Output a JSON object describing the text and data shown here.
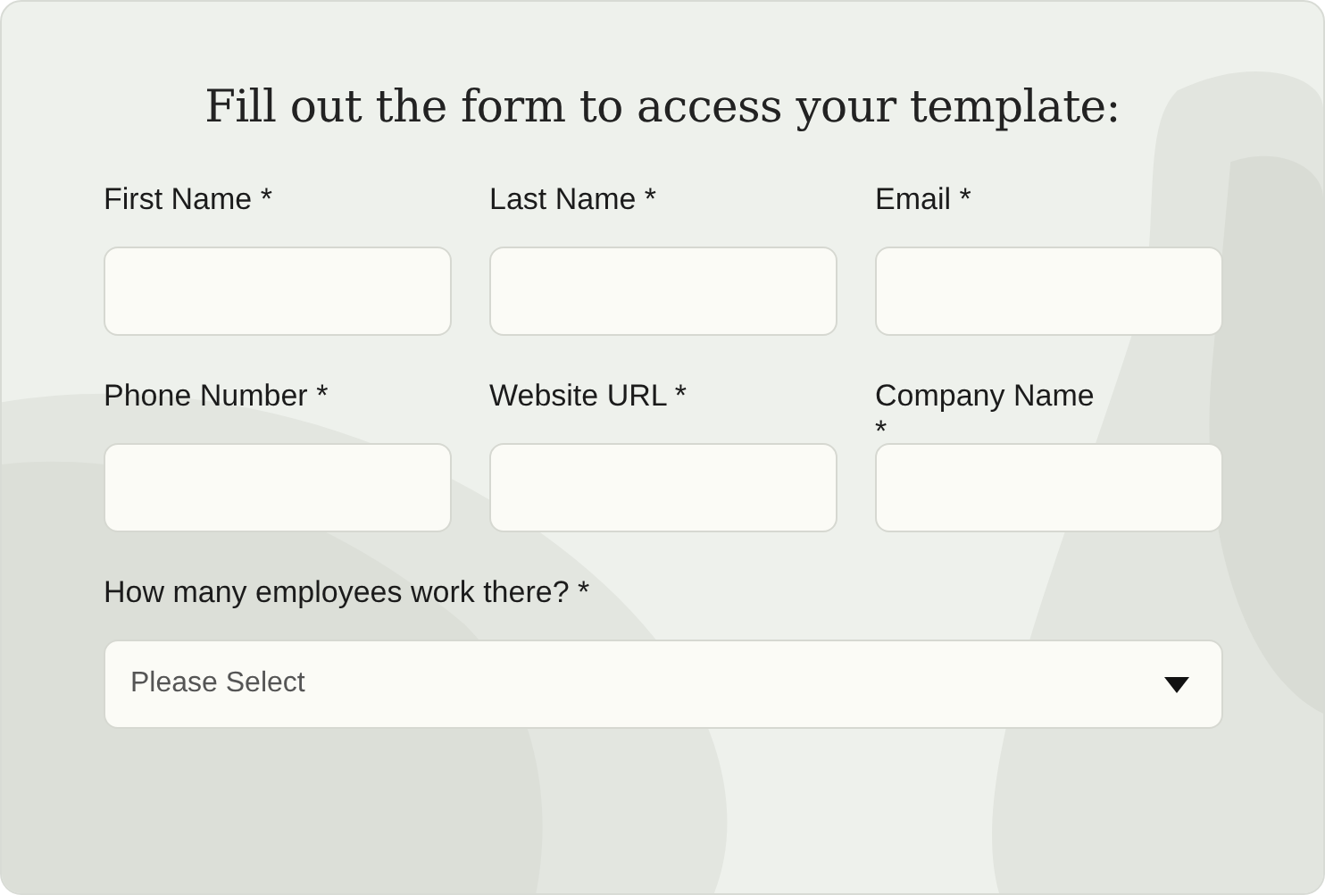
{
  "title": "Fill out the form to access your template:",
  "fields": [
    {
      "label": "First Name *",
      "kind": "text"
    },
    {
      "label": "Last Name *",
      "kind": "text"
    },
    {
      "label": "Email *",
      "kind": "text"
    },
    {
      "label": "Phone Number *",
      "kind": "text"
    },
    {
      "label": "Website URL *",
      "kind": "text"
    },
    {
      "label": "Company Name\n*",
      "kind": "text"
    },
    {
      "label": "How many employees work there? *",
      "kind": "select",
      "placeholder": "Please Select"
    }
  ]
}
